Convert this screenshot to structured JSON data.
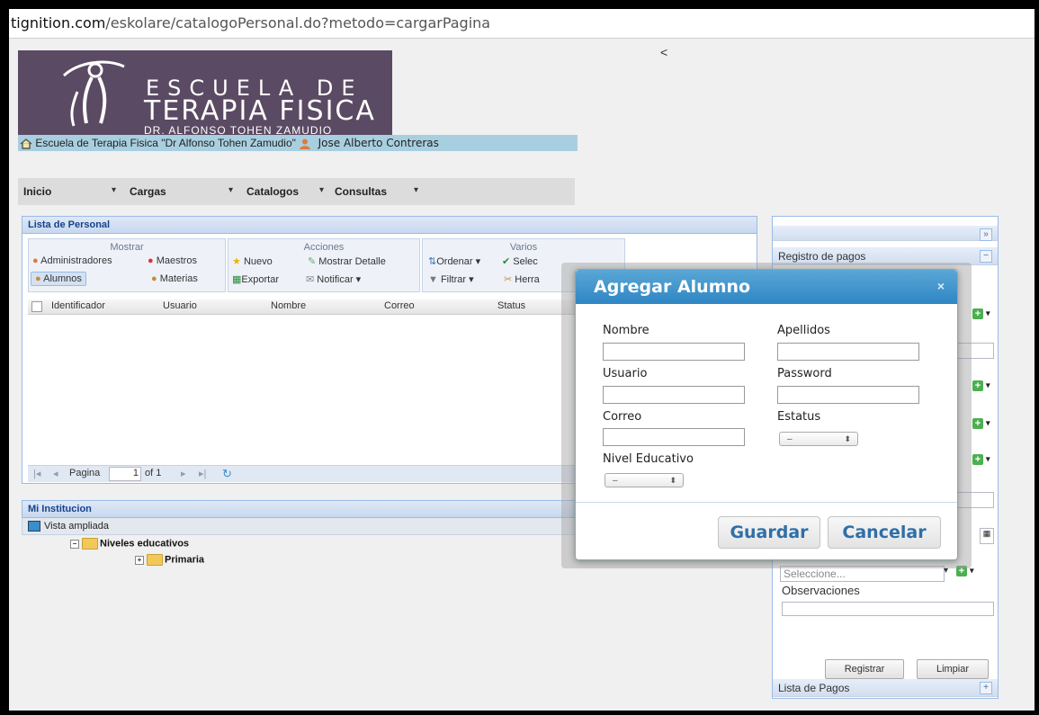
{
  "browser": {
    "url_host": "tignition.com",
    "url_path": "/eskolare/catalogoPersonal.do?metodo=cargarPagina"
  },
  "logo": {
    "line1": "ESCUELA DE",
    "line2": "TERAPIA FISICA",
    "line3": "DR. ALFONSO TOHEN ZAMUDIO"
  },
  "header": {
    "institution": "Escuela de Terapia Fisica \"Dr Alfonso Tohen Zamudio\"",
    "user": "Jose Alberto Contreras",
    "collapse_glyph": "<"
  },
  "menu": [
    {
      "label": "Inicio"
    },
    {
      "label": "Cargas"
    },
    {
      "label": "Catalogos"
    },
    {
      "label": "Consultas"
    }
  ],
  "lista": {
    "title": "Lista de Personal",
    "groups": {
      "mostrar": "Mostrar",
      "acciones": "Acciones",
      "varios": "Varios"
    },
    "buttons": {
      "administradores": "Administradores",
      "maestros": "Maestros",
      "alumnos": "Alumnos",
      "materias": "Materias",
      "nuevo": "Nuevo",
      "mostrar_detalle": "Mostrar Detalle",
      "exportar": "Exportar",
      "notificar": "Notificar ▾",
      "ordenar": "Ordenar ▾",
      "seleccionar": "Selec",
      "filtrar": "Filtrar ▾",
      "herramientas": "Herra"
    },
    "columns": [
      "Identificador",
      "Usuario",
      "Nombre",
      "Correo",
      "Status"
    ],
    "pager": {
      "label": "Pagina",
      "page": "1",
      "of": "of 1"
    }
  },
  "institucion": {
    "title": "Mi Institucion",
    "vista": "Vista ampliada",
    "tree": [
      "Niveles educativos",
      "Primaria"
    ]
  },
  "right_panel": {
    "expand": "»",
    "registro": "Registro de pagos",
    "collapse": "−",
    "select_placeholder": "Seleccione...",
    "observaciones": "Observaciones",
    "registrar": "Registrar",
    "limpiar": "Limpiar",
    "lista_pagos": "Lista de Pagos",
    "lista_toggle": "+"
  },
  "modal": {
    "title": "Agregar Alumno",
    "close": "×",
    "fields": {
      "nombre": "Nombre",
      "apellidos": "Apellidos",
      "usuario": "Usuario",
      "password": "Password",
      "correo": "Correo",
      "estatus": "Estatus",
      "nivel": "Nivel Educativo"
    },
    "select_value": "–",
    "guardar": "Guardar",
    "cancelar": "Cancelar"
  },
  "colors": {
    "modal_header": "#3a8fca",
    "logo_bg": "#5b4a63",
    "panel_border": "#99bbe8",
    "button_text": "#2e6fa8"
  }
}
